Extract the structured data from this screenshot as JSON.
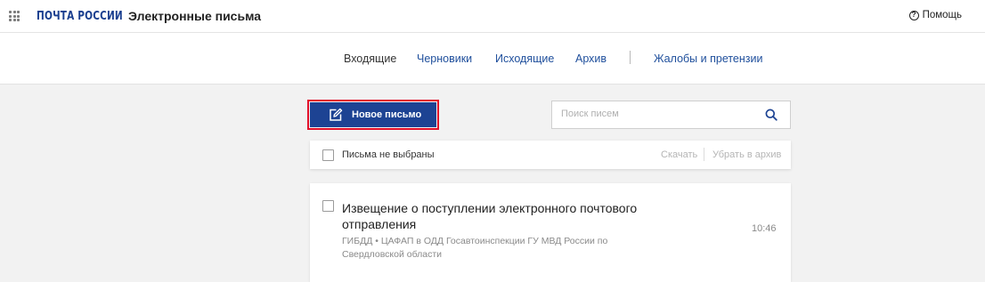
{
  "header": {
    "logo": "ПОЧТА РОССИИ",
    "title": "Электронные письма",
    "help_label": "Помощь",
    "help_icon_glyph": "?"
  },
  "nav": {
    "tabs": [
      {
        "label": "Входящие",
        "active": true
      },
      {
        "label": "Черновики",
        "active": false
      },
      {
        "label": "Исходящие",
        "active": false
      },
      {
        "label": "Архив",
        "active": false
      },
      {
        "label": "Жалобы и претензии",
        "active": false
      }
    ]
  },
  "actions": {
    "new_letter_label": "Новое письмо"
  },
  "search": {
    "placeholder": "Поиск писем",
    "value": ""
  },
  "toolbar": {
    "selection_label": "Письма не выбраны",
    "download_label": "Скачать",
    "archive_label": "Убрать в архив"
  },
  "messages": [
    {
      "subject": "Извещение о поступлении электронного почтового отправления",
      "sender": "ГИБДД • ЦАФАП в ОДД Госавтоинспекции ГУ МВД России по Свердловской области",
      "time": "10:46",
      "selected": false
    }
  ],
  "colors": {
    "brand_blue": "#1d4393",
    "link_blue": "#1f4f9c",
    "highlight_red": "#e2102a",
    "page_background": "#f2f2f2"
  },
  "icons": {
    "apps": "apps-grid-icon",
    "help": "help-circle-icon",
    "new_letter": "edit-icon",
    "search": "search-icon"
  }
}
